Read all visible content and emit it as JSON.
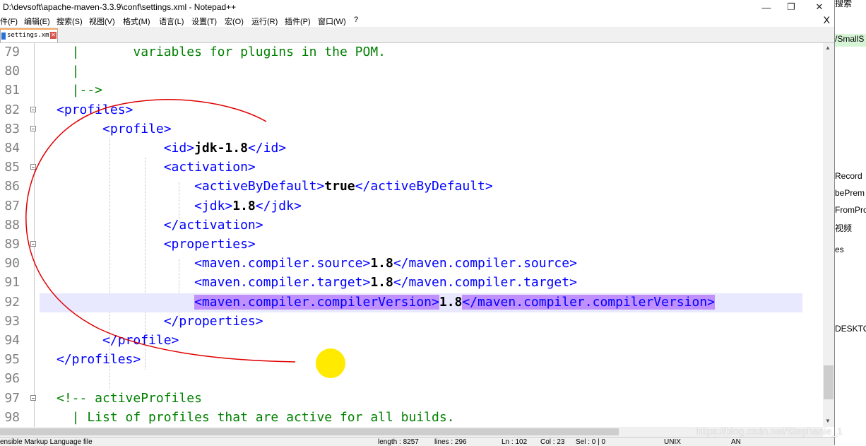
{
  "window": {
    "title": "D:\\devsoft\\apache-maven-3.3.9\\conf\\settings.xml - Notepad++",
    "minimize": "—",
    "maximize": "❐",
    "close": "✕"
  },
  "menu": {
    "items": [
      "件(F)",
      "编辑(E)",
      "搜索(S)",
      "视图(V)",
      "格式(M)",
      "语言(L)",
      "设置(T)",
      "宏(O)",
      "运行(R)",
      "插件(P)",
      "窗口(W)",
      "?"
    ],
    "close": "X"
  },
  "tabs": [
    {
      "label": "settings.xml",
      "close": "✕"
    }
  ],
  "editor": {
    "lines": [
      {
        "num": "79",
        "tokens": [
          {
            "t": "  |       variables for plugins in the POM.",
            "c": "cmt"
          }
        ]
      },
      {
        "num": "80",
        "tokens": [
          {
            "t": "  |",
            "c": "cmt"
          }
        ]
      },
      {
        "num": "81",
        "tokens": [
          {
            "t": "  |-->",
            "c": "cmt"
          }
        ]
      },
      {
        "num": "82",
        "tokens": [
          {
            "t": "<profiles>",
            "c": "tag"
          }
        ],
        "fold": true
      },
      {
        "num": "83",
        "tokens": [
          {
            "t": "      <profile>",
            "c": "tag"
          }
        ],
        "fold": true
      },
      {
        "num": "84",
        "tokens": [
          {
            "t": "              <id>",
            "c": "tag"
          },
          {
            "t": "jdk-1.8",
            "c": "txt"
          },
          {
            "t": "</id>",
            "c": "tag"
          }
        ]
      },
      {
        "num": "85",
        "tokens": [
          {
            "t": "              <activation>",
            "c": "tag"
          }
        ],
        "fold": true
      },
      {
        "num": "86",
        "tokens": [
          {
            "t": "                  <activeByDefault>",
            "c": "tag"
          },
          {
            "t": "true",
            "c": "txt"
          },
          {
            "t": "</activeByDefault>",
            "c": "tag"
          }
        ]
      },
      {
        "num": "87",
        "tokens": [
          {
            "t": "                  <jdk>",
            "c": "tag"
          },
          {
            "t": "1.8",
            "c": "txt"
          },
          {
            "t": "</jdk>",
            "c": "tag"
          }
        ]
      },
      {
        "num": "88",
        "tokens": [
          {
            "t": "              </activation>",
            "c": "tag"
          }
        ]
      },
      {
        "num": "89",
        "tokens": [
          {
            "t": "              <properties>",
            "c": "tag"
          }
        ],
        "fold": true
      },
      {
        "num": "90",
        "tokens": [
          {
            "t": "                  <maven.compiler.source>",
            "c": "tag"
          },
          {
            "t": "1.8",
            "c": "txt"
          },
          {
            "t": "</maven.compiler.source>",
            "c": "tag"
          }
        ]
      },
      {
        "num": "91",
        "tokens": [
          {
            "t": "                  <maven.compiler.target>",
            "c": "tag"
          },
          {
            "t": "1.8",
            "c": "txt"
          },
          {
            "t": "</maven.compiler.target>",
            "c": "tag"
          }
        ]
      },
      {
        "num": "92",
        "current": true,
        "tokens": [
          {
            "t": "                  ",
            "c": "tag"
          },
          {
            "t": "<maven.compiler.compilerVersion>",
            "c": "tag hl"
          },
          {
            "t": "1.8",
            "c": "txt"
          },
          {
            "t": "</maven.compiler.compilerVersion>",
            "c": "tag hl"
          }
        ]
      },
      {
        "num": "93",
        "tokens": [
          {
            "t": "              </properties>",
            "c": "tag"
          }
        ]
      },
      {
        "num": "94",
        "tokens": [
          {
            "t": "      </profile>",
            "c": "tag"
          }
        ]
      },
      {
        "num": "95",
        "tokens": [
          {
            "t": "</profiles>",
            "c": "tag"
          }
        ]
      },
      {
        "num": "96",
        "tokens": [
          {
            "t": "",
            "c": "tag"
          }
        ]
      },
      {
        "num": "97",
        "tokens": [
          {
            "t": "<!-- activeProfiles",
            "c": "cmt"
          }
        ],
        "fold": true
      },
      {
        "num": "98",
        "tokens": [
          {
            "t": "  | List of profiles that are active for all builds.",
            "c": "cmt"
          }
        ]
      }
    ]
  },
  "statusbar": {
    "language": "ensible Markup Language file",
    "length": "length : 8257",
    "lines": "lines : 296",
    "position": "Ln : 102",
    "column": "Col : 23",
    "selection": "Sel : 0 | 0",
    "eol": "UNIX",
    "encoding": "AN"
  },
  "sidepanel": {
    "search": "搜索",
    "header": "/SmallS",
    "items": [
      "Record",
      "bePrem",
      "FromPro",
      "视频",
      "es",
      "DESKTO"
    ]
  },
  "watermark": "https://blog.csdn.net/Stephanie_1",
  "colors": {
    "tag": "#0000ff",
    "comment": "#008000",
    "highlight": "#c090ff",
    "current_line": "#e8e8ff",
    "annotation": "#e00000",
    "cursor_dot": "#ffea00"
  }
}
